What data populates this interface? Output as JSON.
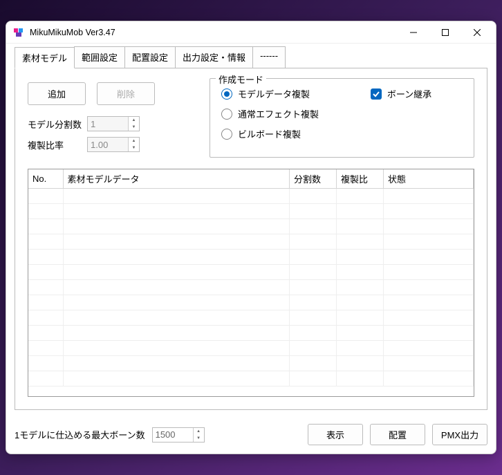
{
  "window": {
    "title": "MikuMikuMob Ver3.47"
  },
  "tabs": [
    {
      "label": "素材モデル",
      "active": true
    },
    {
      "label": "範囲設定",
      "active": false
    },
    {
      "label": "配置設定",
      "active": false
    },
    {
      "label": "出力設定・情報",
      "active": false
    },
    {
      "label": "------",
      "active": false
    }
  ],
  "buttons": {
    "add": "追加",
    "delete": "削除"
  },
  "fields": {
    "split_label": "モデル分割数",
    "split_value": "1",
    "ratio_label": "複製比率",
    "ratio_value": "1.00"
  },
  "group": {
    "title": "作成モード",
    "radios": [
      {
        "label": "モデルデータ複製",
        "checked": true
      },
      {
        "label": "通常エフェクト複製",
        "checked": false
      },
      {
        "label": "ビルボード複製",
        "checked": false
      }
    ],
    "checkbox": {
      "label": "ボーン継承",
      "checked": true
    }
  },
  "table": {
    "columns": [
      {
        "label": "No.",
        "width": "50"
      },
      {
        "label": "素材モデルデータ",
        "width": "260"
      },
      {
        "label": "分割数",
        "width": "68"
      },
      {
        "label": "複製比",
        "width": "68"
      },
      {
        "label": "状態",
        "width": ""
      }
    ],
    "rows": []
  },
  "footer": {
    "max_bone_label": "1モデルに仕込める最大ボーン数",
    "max_bone_value": "1500",
    "buttons": [
      {
        "label": "表示"
      },
      {
        "label": "配置"
      },
      {
        "label": "PMX出力"
      }
    ]
  }
}
